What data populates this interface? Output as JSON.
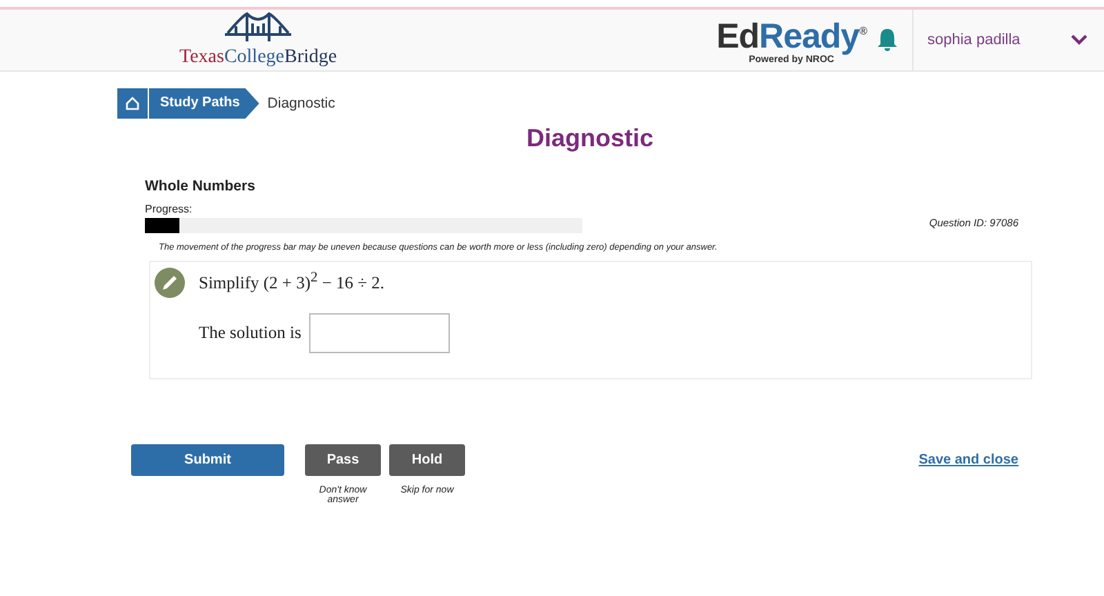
{
  "header": {
    "logo_parts": [
      "Texas",
      "College",
      "Bridge"
    ],
    "brand_parts": [
      "Ed",
      "Ready",
      "®"
    ],
    "brand_tagline": "Powered by NROC",
    "user_name": "sophia padilla"
  },
  "breadcrumb": [
    {
      "label": "Study Paths",
      "kind": "link"
    },
    {
      "label": "Diagnostic",
      "kind": "current"
    }
  ],
  "page_title": "Diagnostic",
  "section_title": "Whole Numbers",
  "progress": {
    "label": "Progress:",
    "level": 0.08
  },
  "question_id": "Question ID: 97086",
  "progress_note": "The movement of the progress bar may be uneven because questions can be worth more or less (including zero) depending on your answer.",
  "question": {
    "prompt": "Simplify (2 + 3)$^{2}$ − 16 ÷ 2.",
    "answer_label": "The solution is"
  },
  "actions": [
    {
      "label": "Submit",
      "kind": "primary"
    },
    {
      "label": "Pass",
      "kind": "secondary",
      "hint": "Don't know answer"
    },
    {
      "label": "Hold",
      "kind": "secondary",
      "hint": "Skip for now"
    }
  ],
  "save_link": "Save and close"
}
